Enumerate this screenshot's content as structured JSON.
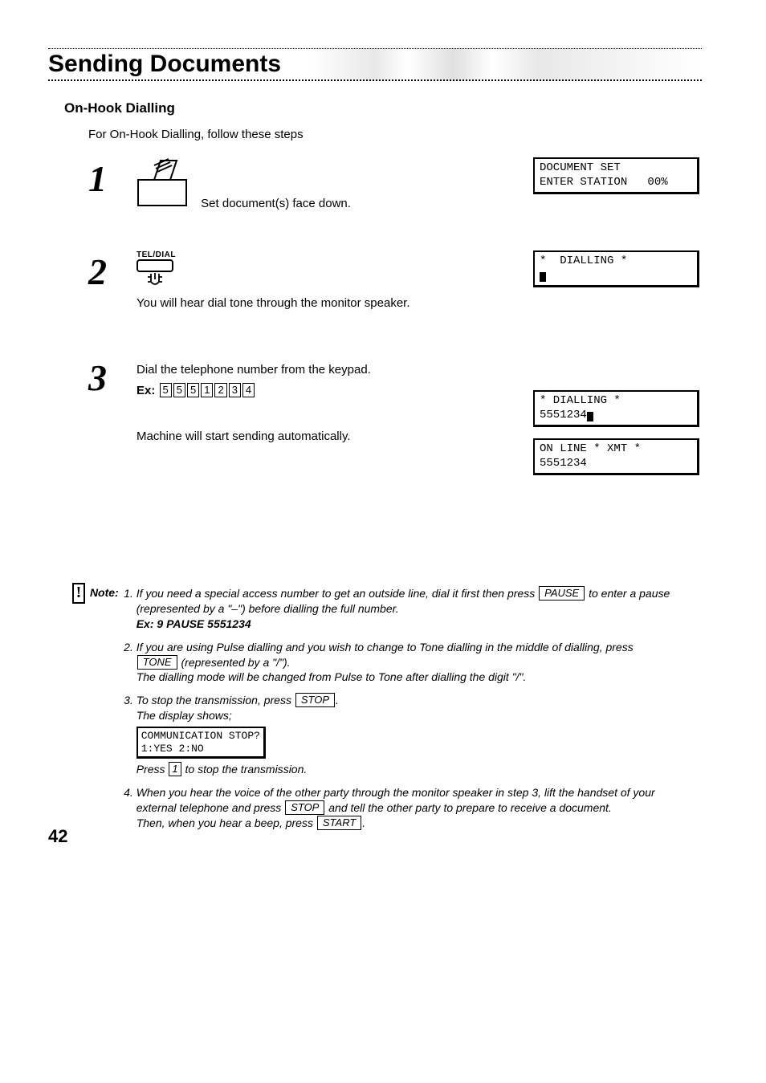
{
  "title": "Sending Documents",
  "subheading": "On-Hook Dialling",
  "intro": "For On-Hook Dialling, follow these steps",
  "steps": {
    "s1": {
      "num": "1",
      "text": "Set document(s) face down.",
      "lcd1_line1": "DOCUMENT SET",
      "lcd1_line2": "ENTER STATION   00%"
    },
    "s2": {
      "num": "2",
      "btn_label": "TEL/DIAL",
      "text": "You will hear dial tone through the monitor speaker.",
      "lcd1_line1": "*  DIALLING *"
    },
    "s3": {
      "num": "3",
      "line1": "Dial the telephone number from the keypad.",
      "ex_label": "Ex:",
      "key1": "5",
      "key2": "5",
      "key3": "5",
      "key4": "1",
      "key5": "2",
      "key6": "3",
      "key7": "4",
      "line2": "Machine will start sending automatically.",
      "lcd1_line1": "* DIALLING *",
      "lcd1_line2": "5551234",
      "lcd2_line1": "ON LINE * XMT *",
      "lcd2_line2": "5551234"
    }
  },
  "note": {
    "label": "Note:",
    "n1_a": "If you need a special access number to get an outside line, dial it first then press ",
    "n1_key": "PAUSE",
    "n1_b": " to enter a pause (represented by a \"–\") before dialling the full number.",
    "n1_ex": "Ex: 9 PAUSE 5551234",
    "n2_a": "If you are using Pulse dialling and you wish to change to Tone dialling in the middle of dialling, press ",
    "n2_key": "TONE",
    "n2_b": " (represented by a \"/\").",
    "n2_c": "The dialling mode will be changed from Pulse to Tone after dialling the digit \"/\".",
    "n3_a": "To stop the transmission, press ",
    "n3_key": "STOP",
    "n3_b": ".",
    "n3_c": "The display shows;",
    "n3_lcd": "COMMUNICATION STOP?\n1:YES 2:NO",
    "n3_d": "Press ",
    "n3_key2": "1",
    "n3_e": " to stop the transmission.",
    "n4_a": "When you hear the voice of the other party through the monitor speaker in step 3, lift the handset of your external telephone and press ",
    "n4_key": "STOP",
    "n4_b": " and tell the other party to prepare to receive a document.",
    "n4_c": "Then, when you hear a beep, press ",
    "n4_key2": "START",
    "n4_d": "."
  },
  "page_number": "42"
}
